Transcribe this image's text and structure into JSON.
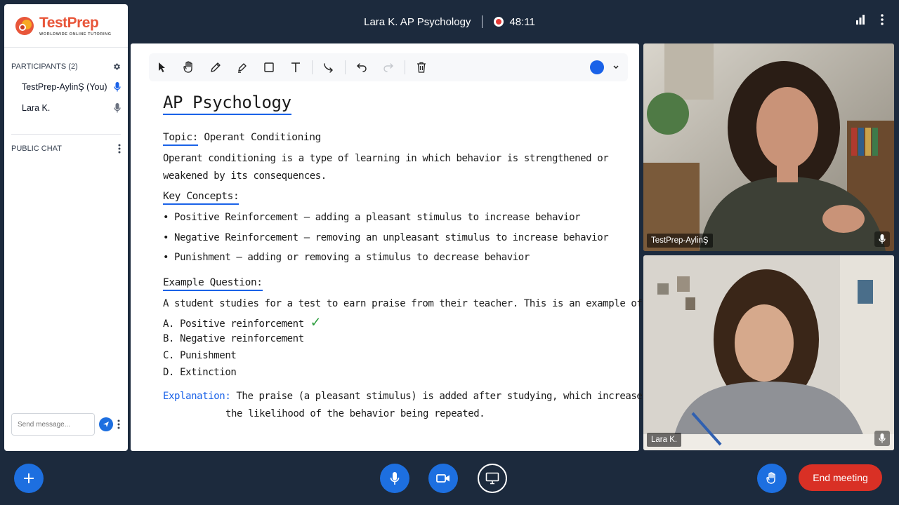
{
  "header": {
    "meeting_title": "Lara K. AP Psychology",
    "timer": "48:11",
    "icons": [
      "signal-bars-icon",
      "more-vert-icon"
    ]
  },
  "brand": {
    "name": "TestPrep",
    "tagline": "WORLDWIDE ONLINE TUTORING",
    "accent": "#e8563a"
  },
  "participants": {
    "title": "PARTICIPANTS (2)",
    "items": [
      {
        "name": "TestPrep-AylinŞ (You)",
        "mic": "active"
      },
      {
        "name": "Lara K.",
        "mic": "idle"
      }
    ]
  },
  "chat": {
    "title": "PUBLIC CHAT",
    "placeholder": "Send message..."
  },
  "whiteboard": {
    "tools": [
      "select",
      "hand",
      "pen",
      "highlighter",
      "rectangle",
      "text",
      "connector",
      "undo",
      "redo",
      "delete"
    ],
    "pen_color": "#1a62e8",
    "title": "AP Psychology",
    "topic_label": "Topic:",
    "topic": "Operant Conditioning",
    "definition_1": "Operant conditioning is a type of learning in which behavior is strengthened or",
    "definition_2": "weakened by its consequences.",
    "key_concepts_label": "Key Concepts:",
    "concepts": [
      "• Positive Reinforcement — adding a pleasant stimulus to increase behavior",
      "• Negative Reinforcement — removing an unpleasant stimulus to increase behavior",
      "• Punishment — adding or removing a stimulus to decrease behavior"
    ],
    "example_label": "Example Question:",
    "question": "A student studies for a test to earn praise from their teacher. This is an example of:",
    "options": [
      "A. Positive reinforcement",
      "B. Negative reinforcement",
      "C. Punishment",
      "D. Extinction"
    ],
    "correct_mark": "✓",
    "explanation_label": "Explanation:",
    "explanation_1": "The praise (a pleasant stimulus) is added after studying, which increases",
    "explanation_2": "the likelihood of the behavior being repeated."
  },
  "videos": [
    {
      "name": "TestPrep-AylinŞ"
    },
    {
      "name": "Lara K."
    }
  ],
  "controls": {
    "end_label": "End meeting",
    "end_color": "#d93025",
    "button_color": "#1d6fe0"
  }
}
